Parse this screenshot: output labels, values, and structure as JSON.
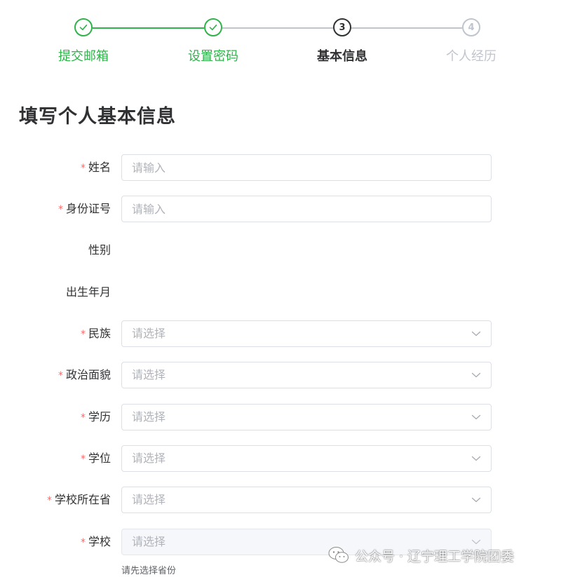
{
  "steps": [
    {
      "index": "1",
      "label": "提交邮箱",
      "status": "done"
    },
    {
      "index": "2",
      "label": "设置密码",
      "status": "done"
    },
    {
      "index": "3",
      "label": "基本信息",
      "status": "active"
    },
    {
      "index": "4",
      "label": "个人经历",
      "status": "todo"
    }
  ],
  "colors": {
    "success": "#2fb34a",
    "active": "#303133",
    "todo": "#c0c4cc",
    "required": "#f56c6c",
    "border": "#dcdfe6"
  },
  "page_title": "填写个人基本信息",
  "form": {
    "name": {
      "label": "姓名",
      "required": "*",
      "placeholder": "请输入"
    },
    "id_number": {
      "label": "身份证号",
      "required": "*",
      "placeholder": "请输入"
    },
    "gender": {
      "label": "性别"
    },
    "birth": {
      "label": "出生年月"
    },
    "ethnicity": {
      "label": "民族",
      "required": "*",
      "placeholder": "请选择"
    },
    "political": {
      "label": "政治面貌",
      "required": "*",
      "placeholder": "请选择"
    },
    "education": {
      "label": "学历",
      "required": "*",
      "placeholder": "请选择"
    },
    "degree": {
      "label": "学位",
      "required": "*",
      "placeholder": "请选择"
    },
    "school_province": {
      "label": "学校所在省",
      "required": "*",
      "placeholder": "请选择"
    },
    "school": {
      "label": "学校",
      "required": "*",
      "placeholder": "请选择",
      "hint": "请先选择省份"
    }
  },
  "watermark": {
    "text": "公众号 · 辽宁理工学院团委",
    "icon": "wechat-icon"
  }
}
